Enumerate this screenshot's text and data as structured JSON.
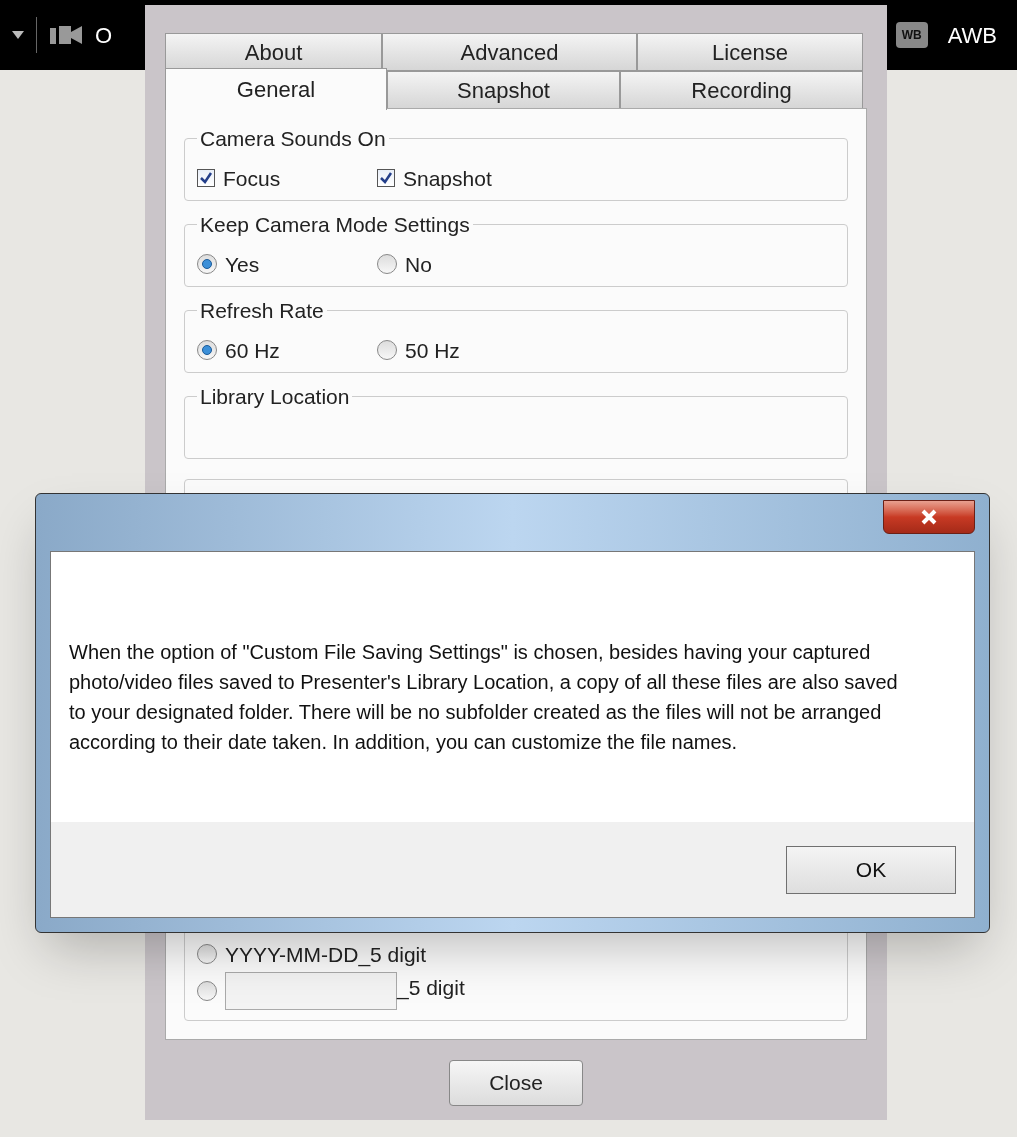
{
  "toolbar": {
    "left_text": "O",
    "wb_badge": "WB",
    "right_text": "AWB"
  },
  "settings": {
    "tab_rows": [
      {
        "tabs": [
          {
            "label": "About",
            "selected": false
          },
          {
            "label": "Advanced",
            "selected": false
          },
          {
            "label": "License",
            "selected": false
          }
        ]
      },
      {
        "tabs": [
          {
            "label": "General",
            "selected": true
          },
          {
            "label": "Snapshot",
            "selected": false
          },
          {
            "label": "Recording",
            "selected": false
          }
        ]
      }
    ],
    "groups": [
      {
        "legend": "Camera Sounds On",
        "options": [
          {
            "kind": "checkbox",
            "label": "Focus",
            "checked": true
          },
          {
            "kind": "checkbox",
            "label": "Snapshot",
            "checked": true
          }
        ]
      },
      {
        "legend": "Keep Camera Mode Settings",
        "options": [
          {
            "kind": "radio",
            "label": "Yes",
            "selected": true
          },
          {
            "kind": "radio",
            "label": "No",
            "selected": false
          }
        ]
      },
      {
        "legend": "Refresh Rate",
        "options": [
          {
            "kind": "radio",
            "label": "60 Hz",
            "selected": true
          },
          {
            "kind": "radio",
            "label": "50 Hz",
            "selected": false
          }
        ]
      },
      {
        "legend": "Library Location"
      }
    ],
    "naming_options": [
      {
        "kind": "radio",
        "label": "YYYY-MM-DD_5 digit",
        "selected": false
      },
      {
        "kind": "radio_field",
        "label": "_5 digit",
        "selected": false
      }
    ],
    "close_button": "Close"
  },
  "message_dialog": {
    "message": "When the option of \"Custom File Saving Settings\" is chosen, besides having your captured photo/video files saved to Presenter's Library Location, a copy of all these files are also saved to your designated folder. There will be no subfolder created as the files will not be arranged according to their date taken. In addition, you can customize the file names.",
    "ok_button": "OK"
  }
}
